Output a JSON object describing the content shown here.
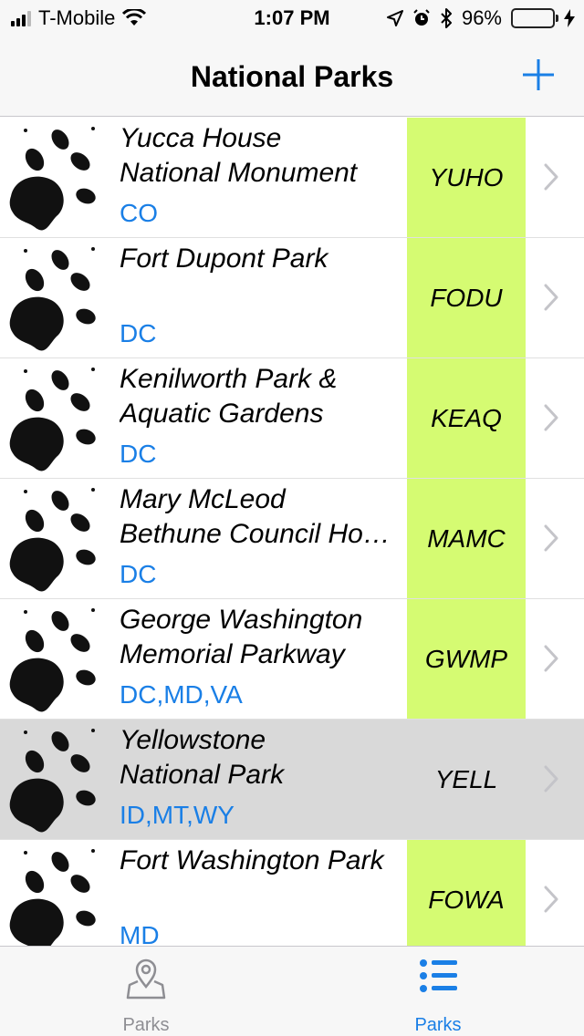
{
  "status_bar": {
    "carrier": "T-Mobile",
    "time": "1:07 PM",
    "battery": "96%",
    "battery_level": 0.96
  },
  "nav": {
    "title": "National Parks",
    "add_icon": "plus-icon"
  },
  "parks": [
    {
      "name": "Yucca House\nNational Monument",
      "states": "CO",
      "code": "YUHO",
      "selected": false
    },
    {
      "name": "Fort Dupont Park",
      "states": "DC",
      "code": "FODU",
      "selected": false
    },
    {
      "name": "Kenilworth Park &\nAquatic Gardens",
      "states": "DC",
      "code": "KEAQ",
      "selected": false
    },
    {
      "name": "Mary McLeod\nBethune Council Ho…",
      "states": "DC",
      "code": "MAMC",
      "selected": false
    },
    {
      "name": "George Washington\nMemorial Parkway",
      "states": "DC,MD,VA",
      "code": "GWMP",
      "selected": false
    },
    {
      "name": "Yellowstone\nNational Park",
      "states": "ID,MT,WY",
      "code": "YELL",
      "selected": true
    },
    {
      "name": "Fort Washington Park",
      "states": "MD",
      "code": "FOWA",
      "selected": false
    }
  ],
  "colors": {
    "accent": "#1a7fe6",
    "code_bg": "#d5fb72",
    "selected_row": "#d9d9d9"
  },
  "tabs": [
    {
      "label": "Parks",
      "icon": "map-pin-icon",
      "active": false
    },
    {
      "label": "Parks",
      "icon": "list-icon",
      "active": true
    }
  ]
}
